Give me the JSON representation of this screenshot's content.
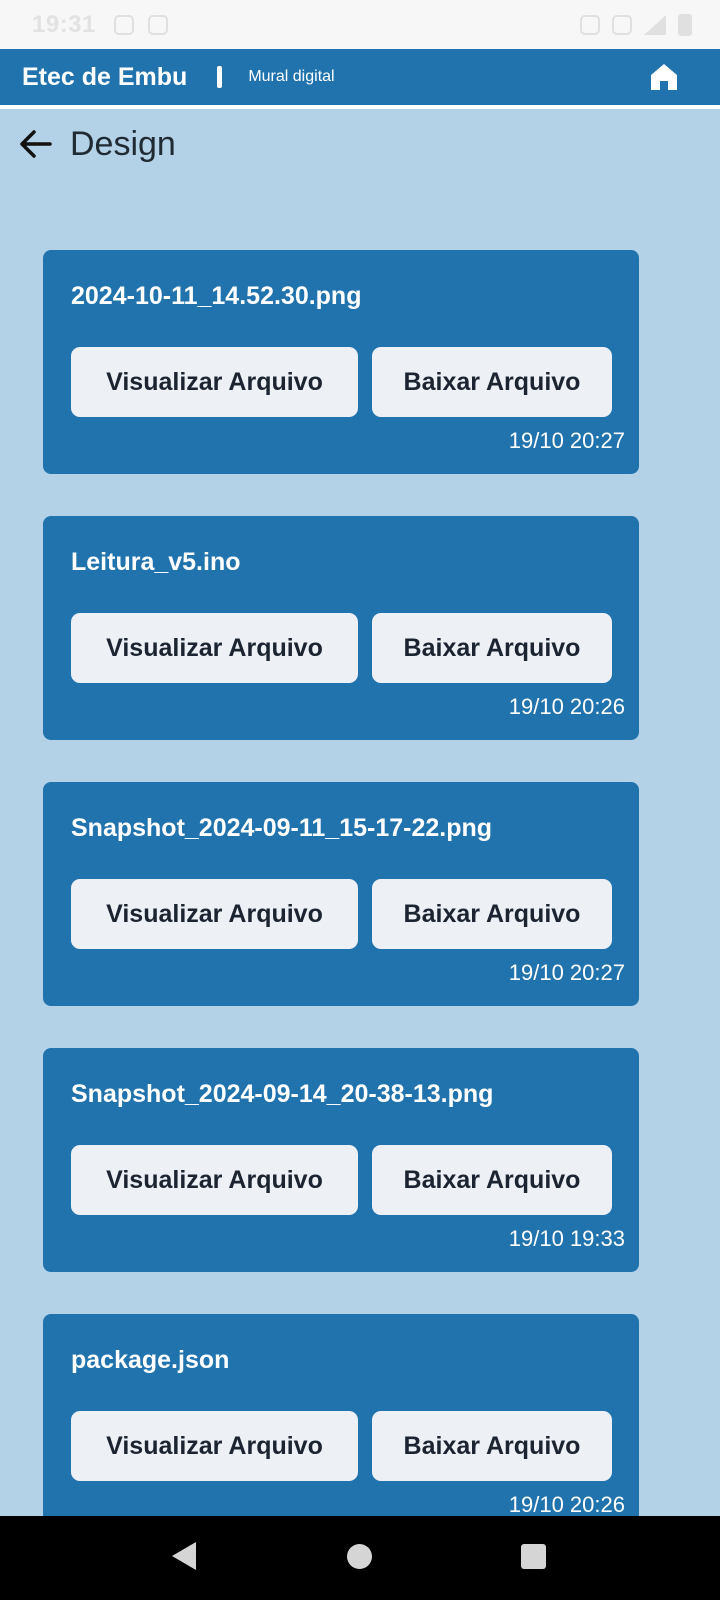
{
  "status_bar": {
    "time": "19:31"
  },
  "app_bar": {
    "title": "Etec de Embu",
    "subtitle": "Mural digital"
  },
  "page": {
    "title": "Design"
  },
  "files": [
    {
      "name": "2024-10-11_14.52.30.png",
      "view_label": "Visualizar Arquivo",
      "download_label": "Baixar Arquivo",
      "date": "19/10 20:27"
    },
    {
      "name": "Leitura_v5.ino",
      "view_label": "Visualizar Arquivo",
      "download_label": "Baixar Arquivo",
      "date": "19/10 20:26"
    },
    {
      "name": "Snapshot_2024-09-11_15-17-22.png",
      "view_label": "Visualizar Arquivo",
      "download_label": "Baixar Arquivo",
      "date": "19/10 20:27"
    },
    {
      "name": "Snapshot_2024-09-14_20-38-13.png",
      "view_label": "Visualizar Arquivo",
      "download_label": "Baixar Arquivo",
      "date": "19/10 19:33"
    },
    {
      "name": "package.json",
      "view_label": "Visualizar Arquivo",
      "download_label": "Baixar Arquivo",
      "date": "19/10 20:26"
    }
  ],
  "colors": {
    "app_bar": "#2173ad",
    "background": "#b3d1e7",
    "card": "#2173ad",
    "button": "#edf1f6"
  },
  "icons": {
    "home": "home-icon",
    "back": "arrow-left-icon"
  }
}
